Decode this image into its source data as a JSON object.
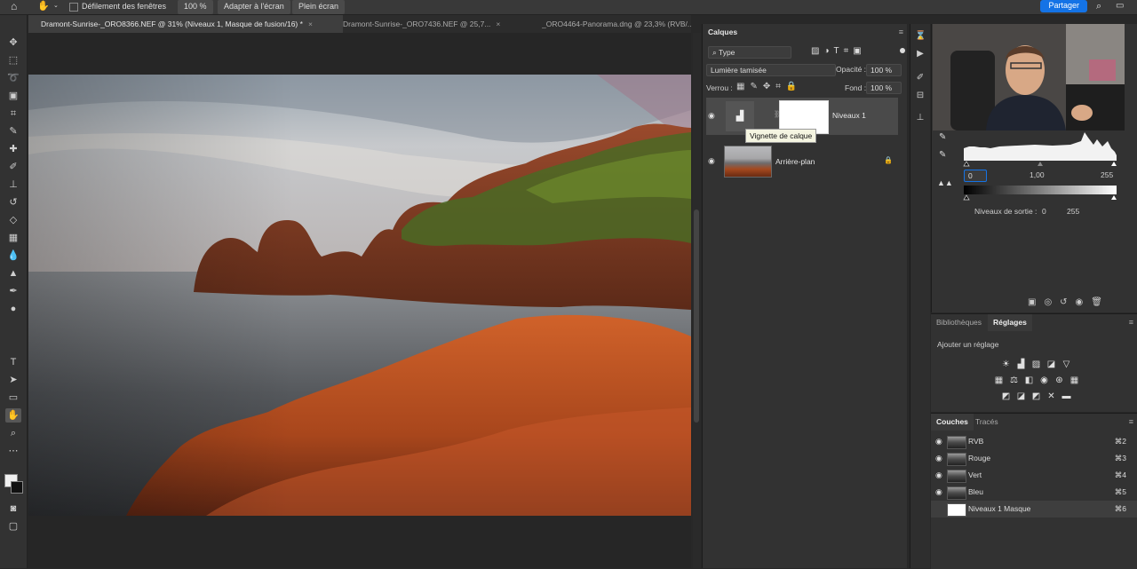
{
  "options_bar": {
    "scroll_all_windows": "Défilement des fenêtres",
    "zoom": "100 %",
    "fit_screen": "Adapter à l'écran",
    "fill_screen": "Plein écran",
    "share": "Partager"
  },
  "tabs": [
    {
      "label": "Dramont-Sunrise-_ORO8366.NEF @ 31% (Niveaux 1, Masque de fusion/16) *",
      "close": "×"
    },
    {
      "label": "Dramont-Sunrise-_ORO7436.NEF @ 25,7...",
      "close": "×"
    },
    {
      "label": "_ORO4464-Panorama.dng @ 23,3% (RVB/...",
      "close": ""
    }
  ],
  "layers_panel": {
    "title": "Calques",
    "filter": "Type",
    "blend_mode": "Lumière tamisée",
    "opacity_label": "Opacité :",
    "opacity_value": "100 %",
    "lock_label": "Verrou :",
    "fill_label": "Fond :",
    "fill_value": "100 %",
    "tooltip": "Vignette de calque",
    "layers": [
      {
        "name": "Niveaux 1"
      },
      {
        "name": "Arrière-plan"
      }
    ]
  },
  "properties": {
    "input_black": "0",
    "input_gamma": "1,00",
    "input_white": "255",
    "output_label": "Niveaux de sortie :",
    "output_black": "0",
    "output_white": "255"
  },
  "adjustments": {
    "tab_libraries": "Bibliothèques",
    "tab_adjustments": "Réglages",
    "add_label": "Ajouter un réglage"
  },
  "channels": {
    "tab_channels": "Couches",
    "tab_paths": "Tracés",
    "rows": [
      {
        "name": "RVB",
        "key": "⌘2"
      },
      {
        "name": "Rouge",
        "key": "⌘3"
      },
      {
        "name": "Vert",
        "key": "⌘4"
      },
      {
        "name": "Bleu",
        "key": "⌘5"
      },
      {
        "name": "Niveaux 1 Masque",
        "key": "⌘6"
      }
    ]
  },
  "colors": {
    "accent": "#1473e6",
    "panel": "#323232",
    "rock": "#b4501e"
  }
}
